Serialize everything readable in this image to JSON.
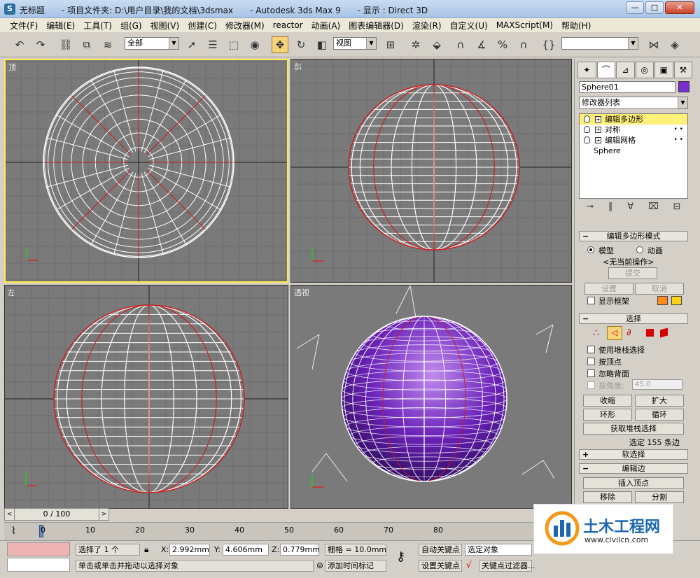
{
  "window": {
    "title": "无标题　　- 项目文件夹: D:\\用户目录\\我的文档\\3dsmax　　- Autodesk 3ds Max 9　　- 显示 : Direct 3D",
    "minimize": "—",
    "maximize": "□",
    "close": "✕"
  },
  "menu": [
    "文件(F)",
    "编辑(E)",
    "工具(T)",
    "组(G)",
    "视图(V)",
    "创建(C)",
    "修改器(M)",
    "reactor",
    "动画(A)",
    "图表编辑器(D)",
    "渲染(R)",
    "自定义(U)",
    "MAXScript(M)",
    "帮助(H)"
  ],
  "toolbar": {
    "selection_filter": "全部",
    "ref_coord": "视图",
    "named_selection": ""
  },
  "viewports": {
    "top": "顶",
    "front": "前",
    "left": "左",
    "perspective": "透视"
  },
  "command_panel": {
    "object_name": "Sphere01",
    "object_color": "#7a2ed1",
    "modifier_list": "修改器列表",
    "stack": [
      {
        "label": "编辑多边形",
        "selected": true
      },
      {
        "label": "对称",
        "selected": false
      },
      {
        "label": "编辑网格",
        "selected": false
      },
      {
        "label": "Sphere",
        "selected": false
      }
    ],
    "edit_poly_mode": {
      "title": "编辑多边形模式",
      "model": "模型",
      "animate": "动画",
      "no_current_op": "<无当前操作>",
      "commit": "提交",
      "settings": "设置",
      "cancel": "取消",
      "show_cage": "显示框架"
    },
    "selection": {
      "title": "选择",
      "use_stack": "使用堆栈选择",
      "by_vertex": "按顶点",
      "ignore_backfacing": "忽略背面",
      "by_angle": "按角度:",
      "angle_value": "45.0",
      "shrink": "收缩",
      "grow": "扩大",
      "ring": "环形",
      "loop": "循环",
      "get_stack_selection": "获取堆栈选择",
      "status": "选定 155 条边"
    },
    "soft_selection": "软选择",
    "edit_edges": {
      "title": "编辑边",
      "insert_vertex": "插入顶点",
      "remove": "移除",
      "split": "分割"
    }
  },
  "timeline": {
    "time_display": "0 / 100",
    "ticks": [
      "0",
      "10",
      "20",
      "30",
      "40",
      "50",
      "60",
      "70",
      "80"
    ]
  },
  "status": {
    "selected_count": "选择了 1 个",
    "x_label": "X:",
    "x_value": "2.992mm",
    "y_label": "Y:",
    "y_value": "4.606mm",
    "z_label": "Z:",
    "z_value": "0.779mm",
    "grid": "栅格 = 10.0mm",
    "auto_key": "自动关键点",
    "set_key": "设置关键点",
    "selected_object": "选定对象",
    "key_filters": "关键点过滤器...",
    "prompt": "单击或单击并拖动以选择对象",
    "add_time_tag": "添加时间标记"
  },
  "watermark": {
    "title": "土木工程网",
    "url": "www.civilcn.com"
  }
}
